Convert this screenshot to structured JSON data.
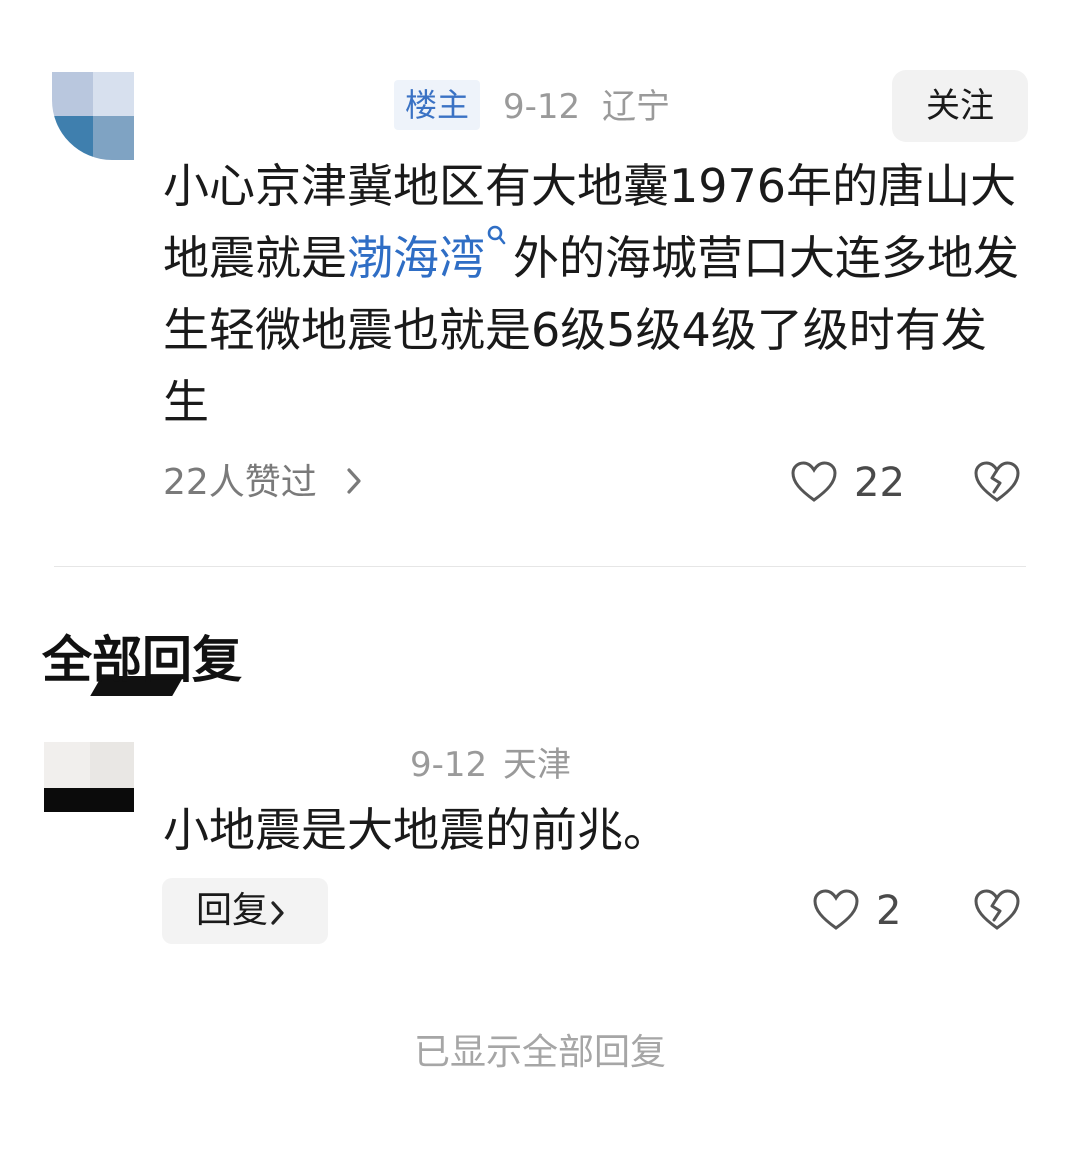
{
  "original_post": {
    "op_badge": "楼主",
    "date": "9-12",
    "location": "辽宁",
    "follow_label": "关注",
    "text_before_link": "小心京津冀地区有大地囊1976年的唐山大地震就是",
    "link_text": "渤海湾",
    "text_after_link": "外的海城营口大连多地发生轻微地震也就是6级5级4级了级时有发生",
    "likers_text": "22人赞过",
    "like_count": "22",
    "link_color": "#2f6ec5"
  },
  "replies_section": {
    "title": "全部回复"
  },
  "replies": [
    {
      "date": "9-12",
      "location": "天津",
      "text": "小地震是大地震的前兆。",
      "reply_label": "回复",
      "like_count": "2"
    }
  ],
  "footer": {
    "all_shown_text": "已显示全部回复"
  },
  "icons": {
    "like": "heart-outline-icon",
    "dislike": "broken-heart-icon",
    "chevron": "chevron-right-icon",
    "search": "search-icon"
  }
}
